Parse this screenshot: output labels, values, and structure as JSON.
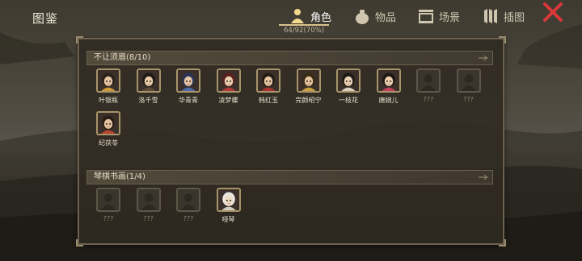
{
  "title": "图鉴",
  "tabs": [
    {
      "label": "角色",
      "icon": "character-icon",
      "active": true
    },
    {
      "label": "物品",
      "icon": "item-bag-icon",
      "active": false
    },
    {
      "label": "场景",
      "icon": "scene-icon",
      "active": false
    },
    {
      "label": "插图",
      "icon": "illustration-icon",
      "active": false
    }
  ],
  "progress": "64/92(70%)",
  "close_icon": "close-x-icon",
  "sections": [
    {
      "header": "不让须眉(8/10)",
      "characters": [
        {
          "name": "叶银瓶",
          "hair": "#2b211a",
          "skin": "#e7c6a2",
          "accent": "#d09a3a",
          "unlocked": true
        },
        {
          "name": "洛千雪",
          "hair": "#1e1a16",
          "skin": "#e9cca9",
          "accent": "#5a4a3a",
          "unlocked": true
        },
        {
          "name": "华青青",
          "hair": "#2a3356",
          "skin": "#e5c5a4",
          "accent": "#4e6aa8",
          "unlocked": true
        },
        {
          "name": "凌梦蝶",
          "hair": "#5a1f1f",
          "skin": "#ead0b0",
          "accent": "#b33a3a",
          "unlocked": true
        },
        {
          "name": "韩红玉",
          "hair": "#221a15",
          "skin": "#e6c7a3",
          "accent": "#a33",
          "unlocked": true
        },
        {
          "name": "完颜昭宁",
          "hair": "#3a2a14",
          "skin": "#e2c29c",
          "accent": "#c9a040",
          "unlocked": true
        },
        {
          "name": "一枝花",
          "hair": "#1d1915",
          "skin": "#ecd2b4",
          "accent": "#d8d0c0",
          "unlocked": true
        },
        {
          "name": "唐婉儿",
          "hair": "#1c1713",
          "skin": "#ebcfae",
          "accent": "#c0405a",
          "unlocked": true
        },
        {
          "name": "???",
          "unlocked": false
        },
        {
          "name": "???",
          "unlocked": false
        },
        {
          "name": "纪茯苓",
          "hair": "#2a1d15",
          "skin": "#e4c3a0",
          "accent": "#b8442e",
          "unlocked": true
        }
      ]
    },
    {
      "header": "琴棋书画(1/4)",
      "characters": [
        {
          "name": "???",
          "unlocked": false
        },
        {
          "name": "???",
          "unlocked": false
        },
        {
          "name": "???",
          "unlocked": false
        },
        {
          "name": "哑琴",
          "hair": "#e8e6e0",
          "skin": "#efdcc4",
          "accent": "#d0ccc0",
          "unlocked": true
        }
      ]
    }
  ],
  "colors": {
    "panel_border": "#6e6350",
    "portrait_border": "#a8946a",
    "accent_gold": "#d8c48e",
    "close_red": "#d8383a"
  }
}
